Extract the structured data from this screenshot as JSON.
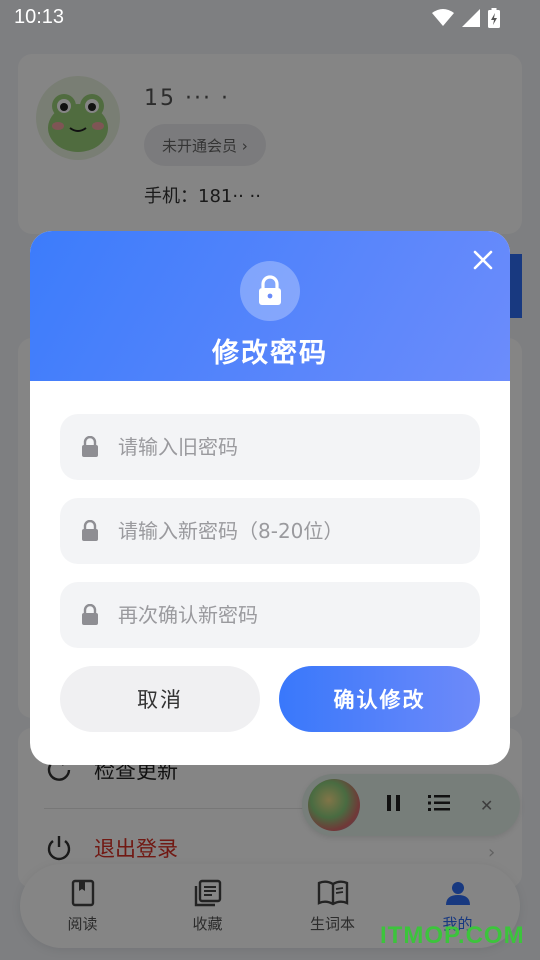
{
  "status_bar": {
    "time": "10:13"
  },
  "profile": {
    "username": "15 ··· ·",
    "member_badge": "未开通会员 ›",
    "phone": "手机：181·· ··"
  },
  "menu": {
    "check_update": "检查更新",
    "logout": "退出登录"
  },
  "tabs": [
    {
      "label": "阅读",
      "icon": "book-icon"
    },
    {
      "label": "收藏",
      "icon": "collection-icon"
    },
    {
      "label": "生词本",
      "icon": "vocabulary-book-icon"
    },
    {
      "label": "我的",
      "icon": "user-icon"
    }
  ],
  "active_tab": "我的",
  "dialog": {
    "title": "修改密码",
    "old_password_placeholder": "请输入旧密码",
    "new_password_placeholder": "请输入新密码（8-20位）",
    "confirm_password_placeholder": "再次确认新密码",
    "cancel_label": "取消",
    "confirm_label": "确认修改"
  },
  "watermark": "ITMOP.COM",
  "colors": {
    "accent": "#3c7cfb",
    "accent_end": "#6c8cfb",
    "logout_text": "#d93025"
  }
}
